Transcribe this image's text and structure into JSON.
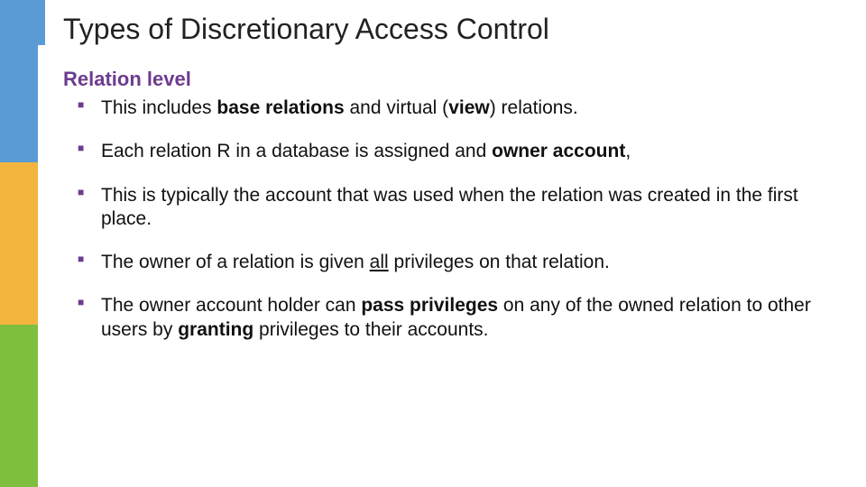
{
  "title": "Types of Discretionary Access Control",
  "subhead": "Relation level",
  "bullets": [
    {
      "parts": [
        {
          "t": "This includes "
        },
        {
          "t": "base relations",
          "b": true
        },
        {
          "t": " and virtual ("
        },
        {
          "t": "view",
          "b": true
        },
        {
          "t": ") relations."
        }
      ]
    },
    {
      "parts": [
        {
          "t": "Each relation R in a database is assigned and "
        },
        {
          "t": "owner account",
          "b": true
        },
        {
          "t": ","
        }
      ]
    },
    {
      "parts": [
        {
          "t": "This is typically the account that was used when the relation was created in the first place."
        }
      ]
    },
    {
      "parts": [
        {
          "t": "The owner of a relation is given "
        },
        {
          "t": "all",
          "u": true
        },
        {
          "t": " privileges on that relation."
        }
      ]
    },
    {
      "parts": [
        {
          "t": "The owner account holder can "
        },
        {
          "t": "pass privileges",
          "b": true
        },
        {
          "t": " on any of the owned relation to other users by "
        },
        {
          "t": "granting",
          "b": true
        },
        {
          "t": " privileges to their accounts."
        }
      ]
    }
  ]
}
